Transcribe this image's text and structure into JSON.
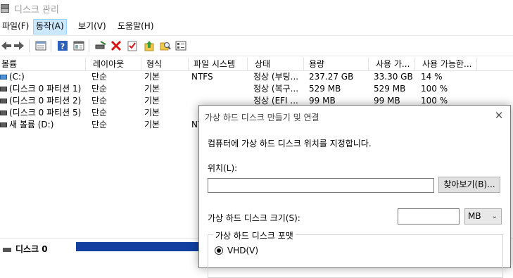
{
  "window": {
    "title": "디스크 관리"
  },
  "menu": {
    "items": [
      "파일(F)",
      "동작(A)",
      "보기(V)",
      "도움말(H)"
    ],
    "active_index": 1
  },
  "toolbar": {
    "icons": [
      "back-arrow-icon",
      "forward-arrow-icon",
      "properties-icon",
      "help-icon",
      "view-icon",
      "connect-disk-icon",
      "delete-icon",
      "check-icon",
      "folder-up-icon",
      "search-folder-icon",
      "list-view-icon"
    ]
  },
  "volume_table": {
    "columns": [
      "볼륨",
      "레이아웃",
      "형식",
      "파일 시스템",
      "상태",
      "용량",
      "사용 가...",
      "사용 가능한..."
    ],
    "rows": [
      {
        "volume": "(C:)",
        "layout": "단순",
        "type": "기본",
        "fs": "NTFS",
        "status": "정상 (부팅...",
        "capacity": "237.27 GB",
        "free": "33.30 GB",
        "pct": "14 %",
        "icon": "system"
      },
      {
        "volume": "(디스크 0 파티션 1)",
        "layout": "단순",
        "type": "기본",
        "fs": "",
        "status": "정상 (복구...",
        "capacity": "529 MB",
        "free": "529 MB",
        "pct": "100 %",
        "icon": "disk"
      },
      {
        "volume": "(디스크 0 파티션 2)",
        "layout": "단순",
        "type": "기본",
        "fs": "",
        "status": "정상 (EFI ...",
        "capacity": "99 MB",
        "free": "99 MB",
        "pct": "100 %",
        "icon": "disk"
      },
      {
        "volume": "(디스크 0 파티션 5)",
        "layout": "단순",
        "type": "기본",
        "fs": "",
        "status": "",
        "capacity": "",
        "free": "",
        "pct": "",
        "icon": "disk"
      },
      {
        "volume": "새 볼륨 (D:)",
        "layout": "단순",
        "type": "기본",
        "fs": "NT",
        "status": "",
        "capacity": "",
        "free": "",
        "pct": "",
        "icon": "disk"
      }
    ]
  },
  "disk_map": {
    "disk_label": "디스크 0",
    "bar_color": "#123fa0"
  },
  "dialog": {
    "title": "가상 하드 디스크 만들기 및 연결",
    "close_label": "✕",
    "instruction": "컴퓨터에 가상 하드 디스크 위치를 지정합니다.",
    "location_label": "위치(L):",
    "location_value": "",
    "browse_label": "찾아보기(B)...",
    "size_label": "가상 하드 디스크 크기(S):",
    "size_value": "",
    "unit_selected": "MB",
    "format_group_title": "가상 하드 디스크 포맷",
    "format_option": "VHD(V)"
  }
}
